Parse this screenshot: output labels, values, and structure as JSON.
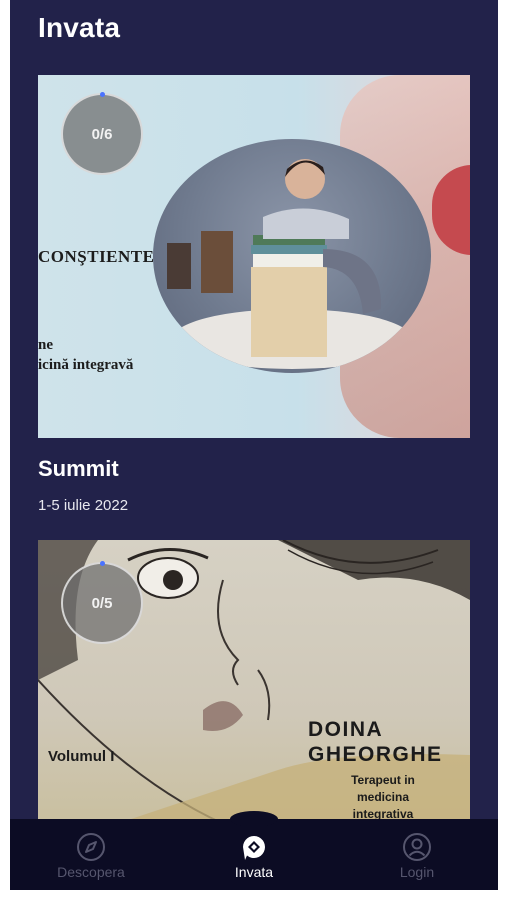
{
  "header": {
    "title": "Invata"
  },
  "cards": [
    {
      "progress": "0/6",
      "cover_text": {
        "word": "CONŞTIENTE",
        "line1": "ne",
        "line2": "icină integravă"
      }
    },
    {
      "progress": "0/5",
      "cover_text": {
        "volume": "Volumul I",
        "author_first": "DOINA",
        "author_last": "GHEORGHE",
        "role_line1": "Terapeut in",
        "role_line2": "medicina",
        "role_line3": "integrativa"
      }
    }
  ],
  "section": {
    "title": "Summit",
    "date": "1-5 iulie 2022"
  },
  "bottom_nav": {
    "items": [
      {
        "label": "Descopera",
        "icon": "compass-icon"
      },
      {
        "label": "Invata",
        "icon": "learn-icon"
      },
      {
        "label": "Login",
        "icon": "user-icon"
      }
    ]
  },
  "colors": {
    "background": "#22224a",
    "nav_background": "#0c0c24",
    "active": "#ffffff",
    "muted": "#56566e",
    "progress_dot": "#4a73ff"
  }
}
